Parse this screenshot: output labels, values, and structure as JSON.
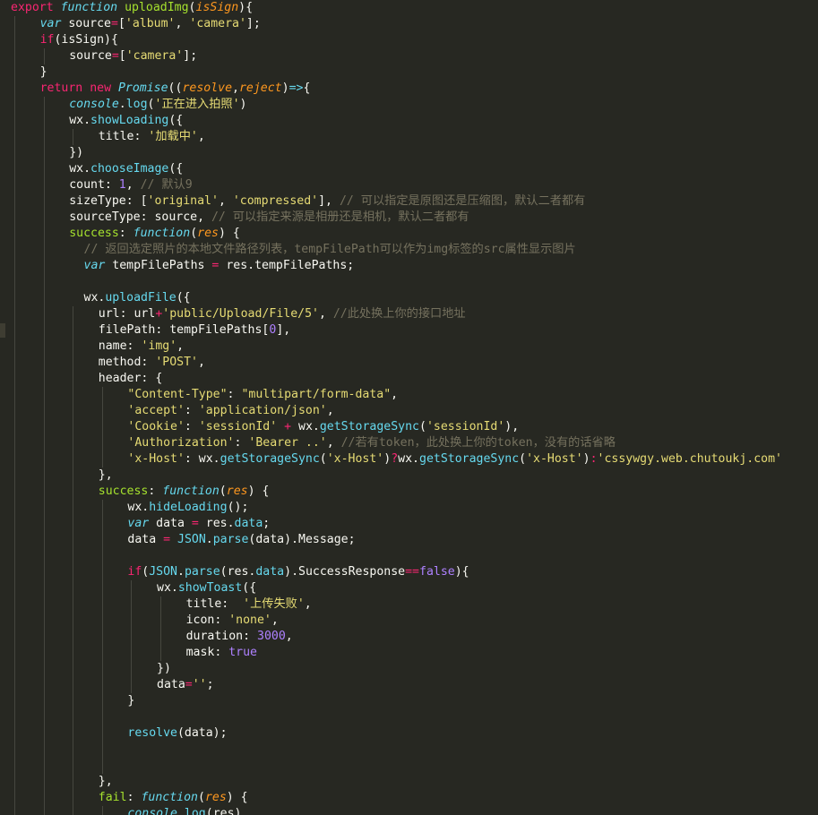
{
  "editor": {
    "colors": {
      "background": "#272822",
      "plain": "#f8f8f2",
      "keyword": "#f92672",
      "storage": "#66d9ef",
      "function_name": "#a6e22e",
      "param": "#fd971f",
      "string": "#e6db74",
      "number": "#ae81ff",
      "comment": "#75715e",
      "guide": "#46473f"
    },
    "lines": [
      {
        "indent": 0,
        "tokens": [
          [
            "export",
            "k"
          ],
          [
            " ",
            ""
          ],
          [
            "function",
            "si"
          ],
          [
            " ",
            ""
          ],
          [
            "uploadImg",
            "f"
          ],
          [
            "(",
            ""
          ],
          [
            "isSign",
            "pi"
          ],
          [
            "){",
            ""
          ]
        ]
      },
      {
        "indent": 1,
        "tokens": [
          [
            "var",
            "si"
          ],
          [
            " source",
            ""
          ],
          [
            "=",
            "k"
          ],
          [
            "[",
            ""
          ],
          [
            "'album'",
            "s"
          ],
          [
            ", ",
            ""
          ],
          [
            "'camera'",
            "s"
          ],
          [
            "];",
            ""
          ]
        ]
      },
      {
        "indent": 1,
        "tokens": [
          [
            "if",
            "k"
          ],
          [
            "(isSign){",
            ""
          ]
        ]
      },
      {
        "indent": 2,
        "tokens": [
          [
            "source",
            ""
          ],
          [
            "=",
            "k"
          ],
          [
            "[",
            ""
          ],
          [
            "'camera'",
            "s"
          ],
          [
            "];",
            ""
          ]
        ]
      },
      {
        "indent": 1,
        "tokens": [
          [
            "}",
            ""
          ]
        ]
      },
      {
        "indent": 1,
        "tokens": [
          [
            "return",
            "k"
          ],
          [
            " ",
            ""
          ],
          [
            "new",
            "k"
          ],
          [
            " ",
            ""
          ],
          [
            "Promise",
            "si"
          ],
          [
            "((",
            ""
          ],
          [
            "resolve",
            "pi"
          ],
          [
            ",",
            ""
          ],
          [
            "reject",
            "pi"
          ],
          [
            ")",
            ""
          ],
          [
            "=>",
            "si"
          ],
          [
            "{",
            ""
          ]
        ]
      },
      {
        "indent": 2,
        "tokens": [
          [
            "console",
            "si"
          ],
          [
            ".",
            ""
          ],
          [
            "log",
            "c"
          ],
          [
            "(",
            ""
          ],
          [
            "'正在进入拍照'",
            "s"
          ],
          [
            ")",
            ""
          ]
        ]
      },
      {
        "indent": 2,
        "tokens": [
          [
            "wx.",
            ""
          ],
          [
            "showLoading",
            "c"
          ],
          [
            "({",
            ""
          ]
        ]
      },
      {
        "indent": 3,
        "tokens": [
          [
            "title: ",
            ""
          ],
          [
            "'加载中'",
            "s"
          ],
          [
            ",",
            ""
          ]
        ]
      },
      {
        "indent": 2,
        "tokens": [
          [
            "})",
            ""
          ]
        ]
      },
      {
        "indent": 2,
        "tokens": [
          [
            "wx.",
            ""
          ],
          [
            "chooseImage",
            "c"
          ],
          [
            "({",
            ""
          ]
        ]
      },
      {
        "indent": 2,
        "tokens": [
          [
            "count: ",
            ""
          ],
          [
            "1",
            "n"
          ],
          [
            ", ",
            ""
          ],
          [
            "// 默认9",
            "cm"
          ]
        ]
      },
      {
        "indent": 2,
        "tokens": [
          [
            "sizeType: [",
            ""
          ],
          [
            "'original'",
            "s"
          ],
          [
            ", ",
            ""
          ],
          [
            "'compressed'",
            "s"
          ],
          [
            "], ",
            ""
          ],
          [
            "// 可以指定是原图还是压缩图，默认二者都有",
            "cm"
          ]
        ]
      },
      {
        "indent": 2,
        "tokens": [
          [
            "sourceType: source, ",
            ""
          ],
          [
            "// 可以指定来源是相册还是相机，默认二者都有",
            "cm"
          ]
        ]
      },
      {
        "indent": 2,
        "tokens": [
          [
            "success",
            "f"
          ],
          [
            ": ",
            ""
          ],
          [
            "function",
            "si"
          ],
          [
            "(",
            ""
          ],
          [
            "res",
            "pi"
          ],
          [
            ") {",
            ""
          ]
        ]
      },
      {
        "indent": 2.5,
        "tokens": [
          [
            "// 返回选定照片的本地文件路径列表，tempFilePath可以作为img标签的src属性显示图片",
            "cm"
          ]
        ]
      },
      {
        "indent": 2.5,
        "tokens": [
          [
            "var",
            "si"
          ],
          [
            " tempFilePaths ",
            ""
          ],
          [
            "=",
            "k"
          ],
          [
            " res.tempFilePaths;",
            ""
          ]
        ]
      },
      {
        "indent": 2.5,
        "tokens": []
      },
      {
        "indent": 2.5,
        "tokens": [
          [
            "wx.",
            ""
          ],
          [
            "uploadFile",
            "c"
          ],
          [
            "({",
            ""
          ]
        ]
      },
      {
        "indent": 3,
        "tokens": [
          [
            "url: url",
            ""
          ],
          [
            "+",
            "k"
          ],
          [
            "'public/Upload/File/5'",
            "s"
          ],
          [
            ", ",
            ""
          ],
          [
            "//此处换上你的接口地址",
            "cm"
          ]
        ]
      },
      {
        "indent": 3,
        "tokens": [
          [
            "filePath: tempFilePaths[",
            ""
          ],
          [
            "0",
            "n"
          ],
          [
            "],",
            ""
          ]
        ]
      },
      {
        "indent": 3,
        "tokens": [
          [
            "name: ",
            ""
          ],
          [
            "'img'",
            "s"
          ],
          [
            ",",
            ""
          ]
        ]
      },
      {
        "indent": 3,
        "tokens": [
          [
            "method: ",
            ""
          ],
          [
            "'POST'",
            "s"
          ],
          [
            ",",
            ""
          ]
        ]
      },
      {
        "indent": 3,
        "tokens": [
          [
            "header: {",
            ""
          ]
        ]
      },
      {
        "indent": 4,
        "tokens": [
          [
            "\"Content-Type\"",
            "s"
          ],
          [
            ": ",
            ""
          ],
          [
            "\"multipart/form-data\"",
            "s"
          ],
          [
            ",",
            ""
          ]
        ]
      },
      {
        "indent": 4,
        "tokens": [
          [
            "'accept'",
            "s"
          ],
          [
            ": ",
            ""
          ],
          [
            "'application/json'",
            "s"
          ],
          [
            ",",
            ""
          ]
        ]
      },
      {
        "indent": 4,
        "tokens": [
          [
            "'Cookie'",
            "s"
          ],
          [
            ": ",
            ""
          ],
          [
            "'sessionId'",
            "s"
          ],
          [
            " ",
            ""
          ],
          [
            "+",
            "k"
          ],
          [
            " wx.",
            ""
          ],
          [
            "getStorageSync",
            "c"
          ],
          [
            "(",
            ""
          ],
          [
            "'sessionId'",
            "s"
          ],
          [
            "),",
            ""
          ]
        ]
      },
      {
        "indent": 4,
        "tokens": [
          [
            "'Authorization'",
            "s"
          ],
          [
            ": ",
            ""
          ],
          [
            "'Bearer ..'",
            "s"
          ],
          [
            ", ",
            ""
          ],
          [
            "//若有token，此处换上你的token，没有的话省略",
            "cm"
          ]
        ]
      },
      {
        "indent": 4,
        "tokens": [
          [
            "'x-Host'",
            "s"
          ],
          [
            ": wx.",
            ""
          ],
          [
            "getStorageSync",
            "c"
          ],
          [
            "(",
            ""
          ],
          [
            "'x-Host'",
            "s"
          ],
          [
            ")",
            ""
          ],
          [
            "?",
            "k"
          ],
          [
            "wx.",
            ""
          ],
          [
            "getStorageSync",
            "c"
          ],
          [
            "(",
            ""
          ],
          [
            "'x-Host'",
            "s"
          ],
          [
            ")",
            ""
          ],
          [
            ":",
            "k"
          ],
          [
            "'cssywgy.web.chutoukj.com'",
            "s"
          ]
        ]
      },
      {
        "indent": 3,
        "tokens": [
          [
            "},",
            ""
          ]
        ]
      },
      {
        "indent": 3,
        "tokens": [
          [
            "success",
            "f"
          ],
          [
            ": ",
            ""
          ],
          [
            "function",
            "si"
          ],
          [
            "(",
            ""
          ],
          [
            "res",
            "pi"
          ],
          [
            ") {",
            ""
          ]
        ]
      },
      {
        "indent": 4,
        "tokens": [
          [
            "wx.",
            ""
          ],
          [
            "hideLoading",
            "c"
          ],
          [
            "();",
            ""
          ]
        ]
      },
      {
        "indent": 4,
        "tokens": [
          [
            "var",
            "si"
          ],
          [
            " data ",
            ""
          ],
          [
            "=",
            "k"
          ],
          [
            " res.",
            ""
          ],
          [
            "data",
            "c"
          ],
          [
            ";",
            ""
          ]
        ]
      },
      {
        "indent": 4,
        "tokens": [
          [
            "data ",
            ""
          ],
          [
            "=",
            "k"
          ],
          [
            " ",
            ""
          ],
          [
            "JSON",
            "c"
          ],
          [
            ".",
            ""
          ],
          [
            "parse",
            "c"
          ],
          [
            "(data).Message;",
            ""
          ]
        ]
      },
      {
        "indent": 4,
        "tokens": []
      },
      {
        "indent": 4,
        "tokens": [
          [
            "if",
            "k"
          ],
          [
            "(",
            ""
          ],
          [
            "JSON",
            "c"
          ],
          [
            ".",
            ""
          ],
          [
            "parse",
            "c"
          ],
          [
            "(res.",
            ""
          ],
          [
            "data",
            "c"
          ],
          [
            ").SuccessResponse",
            ""
          ],
          [
            "==",
            "k"
          ],
          [
            "false",
            "n"
          ],
          [
            "){",
            ""
          ]
        ]
      },
      {
        "indent": 5,
        "tokens": [
          [
            "wx.",
            ""
          ],
          [
            "showToast",
            "c"
          ],
          [
            "({",
            ""
          ]
        ]
      },
      {
        "indent": 6,
        "tokens": [
          [
            "title:  ",
            ""
          ],
          [
            "'上传失败'",
            "s"
          ],
          [
            ",",
            ""
          ]
        ]
      },
      {
        "indent": 6,
        "tokens": [
          [
            "icon: ",
            ""
          ],
          [
            "'none'",
            "s"
          ],
          [
            ",",
            ""
          ]
        ]
      },
      {
        "indent": 6,
        "tokens": [
          [
            "duration: ",
            ""
          ],
          [
            "3000",
            "n"
          ],
          [
            ",",
            ""
          ]
        ]
      },
      {
        "indent": 6,
        "tokens": [
          [
            "mask: ",
            ""
          ],
          [
            "true",
            "n"
          ]
        ]
      },
      {
        "indent": 5,
        "tokens": [
          [
            "})",
            ""
          ]
        ]
      },
      {
        "indent": 5,
        "tokens": [
          [
            "data",
            ""
          ],
          [
            "=",
            "k"
          ],
          [
            "''",
            "s"
          ],
          [
            ";",
            ""
          ]
        ]
      },
      {
        "indent": 4,
        "tokens": [
          [
            "}",
            ""
          ]
        ]
      },
      {
        "indent": 4,
        "tokens": []
      },
      {
        "indent": 4,
        "tokens": [
          [
            "resolve",
            "c"
          ],
          [
            "(data);",
            ""
          ]
        ]
      },
      {
        "indent": 4,
        "tokens": []
      },
      {
        "indent": 4,
        "tokens": []
      },
      {
        "indent": 3,
        "tokens": [
          [
            "},",
            ""
          ]
        ]
      },
      {
        "indent": 3,
        "tokens": [
          [
            "fail",
            "f"
          ],
          [
            ": ",
            ""
          ],
          [
            "function",
            "si"
          ],
          [
            "(",
            ""
          ],
          [
            "res",
            "pi"
          ],
          [
            ") {",
            ""
          ]
        ]
      },
      {
        "indent": 4,
        "tokens": [
          [
            "console",
            "si"
          ],
          [
            ".",
            ""
          ],
          [
            "log",
            "c"
          ],
          [
            "(res)",
            ""
          ]
        ]
      }
    ]
  }
}
